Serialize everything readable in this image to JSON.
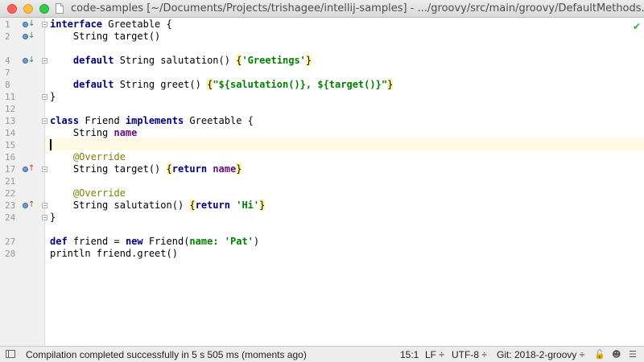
{
  "window": {
    "title": "code-samples [~/Documents/Projects/trishagee/intellij-samples] - .../groovy/src/main/groovy/DefaultMethods.gro..."
  },
  "editor": {
    "line_numbers": [
      "1",
      "2",
      "4",
      "7",
      "8",
      "11",
      "12",
      "13",
      "14",
      "15",
      "16",
      "17",
      "21",
      "22",
      "23",
      "24",
      "27",
      "28"
    ],
    "text": {
      "l1_kw": "interface",
      "l1_rest": " Greetable {",
      "l2": "    String target()",
      "l4_indent": "    ",
      "l4_kw": "default",
      "l4_mid": " String salutation() ",
      "l4_open": "{",
      "l4_str": "'Greetings'",
      "l4_close": "}",
      "l8_indent": "    ",
      "l8_kw": "default",
      "l8_mid": " String greet() ",
      "l8_open": "{",
      "l8_str1": "\"${salutation()}, ${target()}\"",
      "l8_close": "}",
      "l11": "}",
      "l13_kw1": "class",
      "l13_mid": " Friend ",
      "l13_kw2": "implements",
      "l13_rest": " Greetable {",
      "l14_pre": "    String ",
      "l14_fld": "name",
      "l16_indent": "    ",
      "l16_ann": "@Override",
      "l17_pre": "    String target() ",
      "l17_open": "{",
      "l17_kw": "return",
      "l17_sp": " ",
      "l17_fld": "name",
      "l17_close": "}",
      "l21_indent": "    ",
      "l21_ann": "@Override",
      "l22_pre": "    String salutation() ",
      "l22_open": "{",
      "l22_kw": "return",
      "l22_sp": " ",
      "l22_str": "'Hi'",
      "l22_close": "}",
      "l23": "}",
      "l27_kw1": "def",
      "l27_mid": " friend = ",
      "l27_kw2": "new",
      "l27_mid2": " Friend(",
      "l27_named": "name:",
      "l27_sp": " ",
      "l27_str": "'Pat'",
      "l27_end": ")",
      "l28": "println friend.greet()"
    }
  },
  "status_bar": {
    "message": "Compilation completed successfully in 5 s 505 ms (moments ago)",
    "position": "15:1",
    "line_separator": "LF ÷",
    "encoding": "UTF-8 ÷",
    "git_branch": "Git: 2018-2-groovy ÷"
  },
  "icons": {
    "implemented_marker": "implemented-down-arrow-icon",
    "override_marker": "override-up-arrow-icon",
    "fold": "fold-icon",
    "inspection_ok": "check-icon",
    "lock": "lock-icon",
    "inspector": "hector-icon",
    "event_log": "event-log-icon"
  }
}
